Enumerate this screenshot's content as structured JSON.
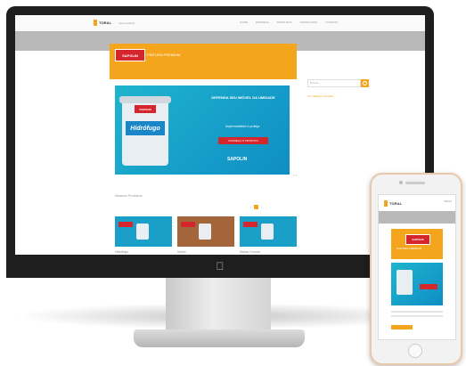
{
  "desktop": {
    "site": {
      "logo": "TORAL",
      "logo_sub": "santo antônio",
      "nav": [
        "HOME",
        "EMPRESA",
        "PRODUTOS",
        "DOWNLOADS",
        "CONTATO"
      ],
      "banner_brand": "SAPOLIN",
      "banner_caption": "PINTURA PREMIUM",
      "hero": {
        "headline": "DEFENDA SEU IMÓVEL DA UMIDADE",
        "sub": "Impermeabilize e proteja",
        "cta": "CONHEÇA O PRODUTO",
        "product": "Hidrófugo",
        "brand_footer": "SAPOLIN",
        "controls": "‹ ›"
      },
      "search_placeholder": "Buscar...",
      "sidebar_link": "Ver catálogo completo",
      "section_title": "Nossos Produtos",
      "pager": [
        "‹",
        "›"
      ],
      "cards": [
        {
          "caption": "Hidrófugo",
          "color": "#1aa0c8"
        },
        {
          "caption": "Verniz",
          "color": "#a4653a"
        },
        {
          "caption": "Massa Corrida",
          "color": "#1aa0c8"
        }
      ]
    }
  },
  "phone": {
    "logo": "TORAL",
    "nav": "MENU",
    "banner_brand": "SAPOLIN",
    "banner_caption": "PINTURA PREMIUM"
  },
  "colors": {
    "accent": "#f4a51c",
    "brand_red": "#d6262d",
    "hero_blue": "#1fb4cf"
  }
}
